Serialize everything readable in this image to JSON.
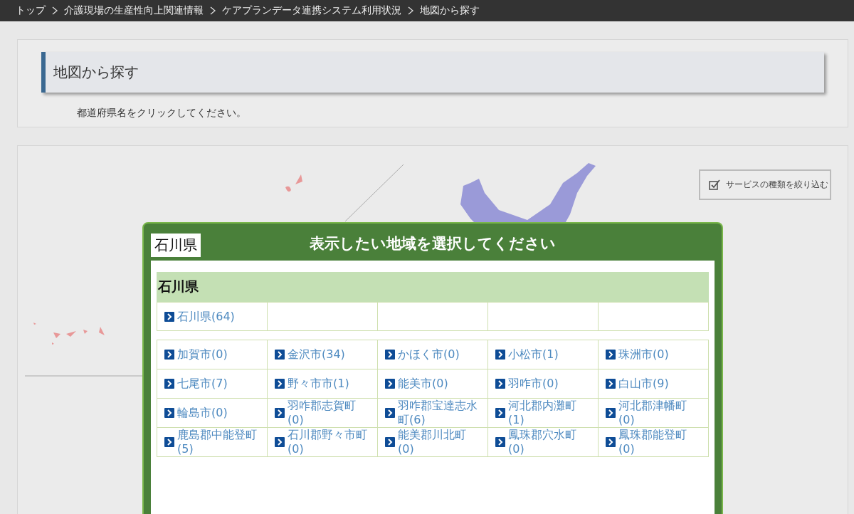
{
  "breadcrumb": [
    "トップ",
    "介護現場の生産性向上関連情報",
    "ケアプランデータ連携システム利用状況",
    "地図から探す"
  ],
  "page_title": "地図から探す",
  "instruction": "都道府県名をクリックしてください。",
  "filter_button": {
    "label": "サービスの種類を絞り込む"
  },
  "modal": {
    "badge": "石川県",
    "title": "表示したい地域を選択してください",
    "prefecture_heading": "石川県",
    "top_links": [
      "石川県(64)"
    ],
    "links": [
      "加賀市(0)",
      "金沢市(34)",
      "かほく市(0)",
      "小松市(1)",
      "珠洲市(0)",
      "七尾市(7)",
      "野々市市(1)",
      "能美市(0)",
      "羽咋市(0)",
      "白山市(9)",
      "輪島市(0)",
      "羽咋郡志賀町(0)",
      "羽咋郡宝達志水町(6)",
      "河北郡内灘町(1)",
      "河北郡津幡町(0)",
      "鹿島郡中能登町(5)",
      "石川郡野々市町(0)",
      "能美郡川北町(0)",
      "鳳珠郡穴水町(0)",
      "鳳珠郡能登町(0)"
    ]
  }
}
